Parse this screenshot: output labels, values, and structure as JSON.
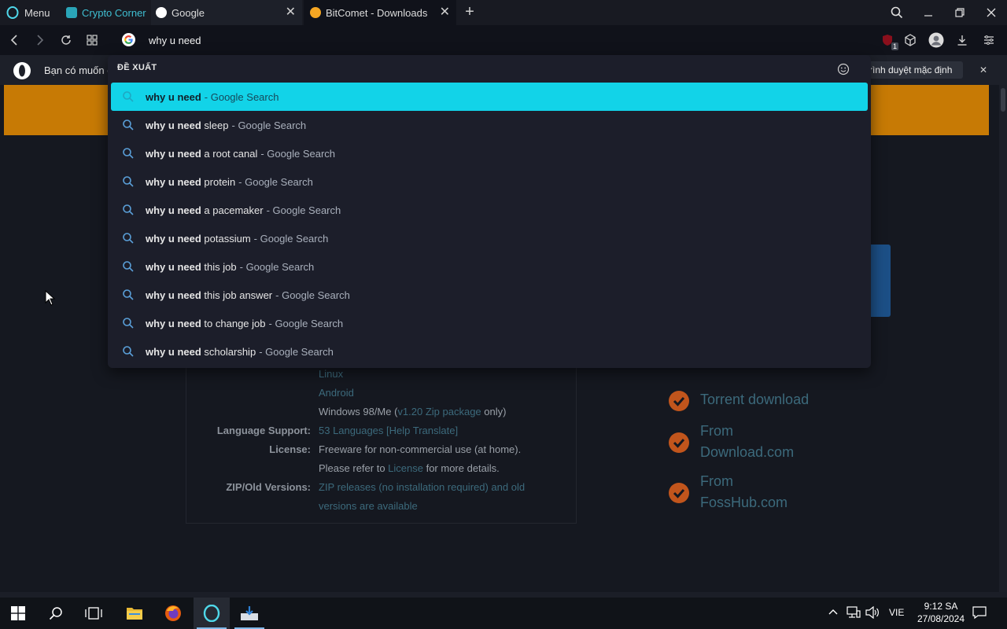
{
  "tabs": [
    {
      "label": "Menu"
    },
    {
      "label": "Crypto Corner"
    },
    {
      "label": "Google"
    },
    {
      "label": "BitComet - Downloads"
    }
  ],
  "address": {
    "value": "why u need"
  },
  "ublock_badge": "1",
  "infobar": {
    "text": "Bạn có muốn đ",
    "button_label": "rình duyệt mặc định"
  },
  "dropdown": {
    "heading": "ĐỀ XUẤT",
    "suggestions": [
      {
        "bold": "why u need",
        "rest": "",
        "suffix": "- Google Search"
      },
      {
        "bold": "why u need",
        "rest": "sleep",
        "suffix": "- Google Search"
      },
      {
        "bold": "why u need",
        "rest": "a root canal",
        "suffix": "- Google Search"
      },
      {
        "bold": "why u need",
        "rest": "protein",
        "suffix": "- Google Search"
      },
      {
        "bold": "why u need",
        "rest": "a pacemaker",
        "suffix": "- Google Search"
      },
      {
        "bold": "why u need",
        "rest": "potassium",
        "suffix": "- Google Search"
      },
      {
        "bold": "why u need",
        "rest": "this job",
        "suffix": "- Google Search"
      },
      {
        "bold": "why u need",
        "rest": "this job answer",
        "suffix": "- Google Search"
      },
      {
        "bold": "why u need",
        "rest": "to change job",
        "suffix": "- Google Search"
      },
      {
        "bold": "why u need",
        "rest": "scholarship",
        "suffix": "- Google Search"
      }
    ]
  },
  "page": {
    "os_list": [
      "Linux",
      "Android"
    ],
    "win98_prefix": "Windows 98/Me (",
    "win98_link": "v1.20 Zip package",
    "win98_suffix": " only)",
    "lang_label": "Language Support:",
    "lang_link": "53 Languages",
    "lang_help": "[Help Translate]",
    "license_label": "License:",
    "license_text": "Freeware for non-commercial use (at home).",
    "license_line2_prefix": "Please refer to ",
    "license_link": "License",
    "license_line2_suffix": " for more details.",
    "zip_label": "ZIP/Old Versions:",
    "zip_line1": "ZIP releases (no installation required) and old",
    "zip_line2": "versions are available",
    "download_links": [
      {
        "line1": "Torrent download",
        "line2": ""
      },
      {
        "line1": "From",
        "line2": "Download.com"
      },
      {
        "line1": "From",
        "line2": "FossHub.com"
      }
    ]
  },
  "tray": {
    "lang": "VIE",
    "time": "9:12 SA",
    "date": "27/08/2024"
  },
  "colors": {
    "accent_cyan": "#12d3e8",
    "opera_red": "#ff1b2d",
    "banner_orange": "#c77a05"
  }
}
